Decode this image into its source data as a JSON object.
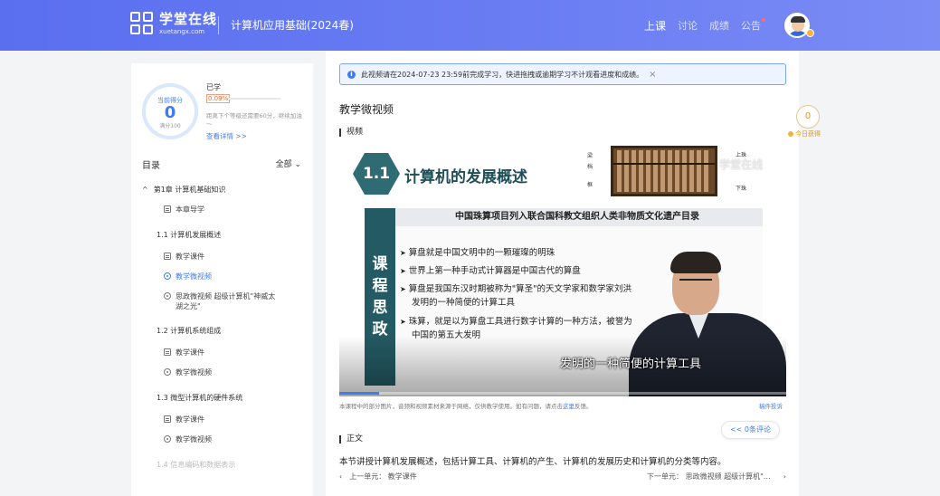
{
  "header": {
    "logo_cn": "学堂在线",
    "logo_en": "xuetangx.com",
    "course_title": "计算机应用基础(2024春)",
    "nav": [
      "上课",
      "讨论",
      "成绩",
      "公告"
    ]
  },
  "progress_card": {
    "score_label": "当前得分",
    "score": "0",
    "full_score": "满分100",
    "learned_label": "已学",
    "learned_percent": "0.09%",
    "tip": "距离下个等级还需要60分，继续加油～",
    "detail_link": "查看详情 >>"
  },
  "toc": {
    "title": "目录",
    "filter": "全部",
    "items": [
      {
        "text": "第1章 计算机基础知识",
        "kind": "chapter"
      },
      {
        "text": "本章导学",
        "kind": "doc"
      },
      {
        "text": "1.1 计算机发展概述",
        "kind": "section"
      },
      {
        "text": "教学课件",
        "kind": "doc"
      },
      {
        "text": "教学微视频",
        "kind": "video",
        "active": true
      },
      {
        "text": "思政微视频 超级计算机\"神威太",
        "kind": "video"
      },
      {
        "text": "湖之光\"",
        "kind": "cont"
      },
      {
        "text": "1.2 计算机系统组成",
        "kind": "section"
      },
      {
        "text": "教学课件",
        "kind": "doc"
      },
      {
        "text": "教学微视频",
        "kind": "video"
      },
      {
        "text": "1.3 微型计算机的硬件系统",
        "kind": "section"
      },
      {
        "text": "教学课件",
        "kind": "doc"
      },
      {
        "text": "教学微视频",
        "kind": "video"
      },
      {
        "text": "1.4 信息编码和数据表示",
        "kind": "section"
      }
    ]
  },
  "main": {
    "notice": "此视频请在2024-07-23 23:59前完成学习，快进拖拽或逾期学习不计观看进度和成绩。",
    "section_title": "教学微视频",
    "video_label": "视频",
    "slide": {
      "number": "1.1",
      "title": "计算机的发展概述",
      "abacus_labels": [
        "梁",
        "档",
        "框",
        "上珠",
        "下珠"
      ],
      "watermark": "学堂在线",
      "heading": "中国珠算项目列入联合国科教文组织人类非物质文化遗产目录",
      "band": [
        "课",
        "程",
        "思",
        "政"
      ],
      "bullets": [
        "算盘就是中国文明中的一颗璀璨的明珠",
        "世界上第一种手动式计算器是中国古代的算盘",
        "算盘是我国东汉时期被称为\"算圣\"的天文学家和数学家刘洪发明的一种简便的计算工具",
        "珠算，就是以为算盘工具进行数字计算的一种方法，被誉为中国的第五大发明"
      ],
      "caption": "发明的一种简便的计算工具"
    },
    "video_progress": 0.09,
    "disclaimer": "本课程中的部分图片，音频和视频素材来源于网络，仅供教学使用。如有问题，请点击",
    "disclaimer_link": "这里",
    "disclaimer_tail": "反馈。",
    "report": "稿件投诉",
    "body_label": "正文",
    "body_text": "本节讲授计算机发展概述，包括计算工具、计算机的产生、计算机的发展历史和计算机的分类等内容。",
    "prev": "上一单元：  教学课件",
    "next": "下一单元：  思政微视频 超级计算机\"…"
  },
  "floating": {
    "today_score": "0",
    "today_label": "今日获得",
    "comments": "<< 0条评论"
  }
}
